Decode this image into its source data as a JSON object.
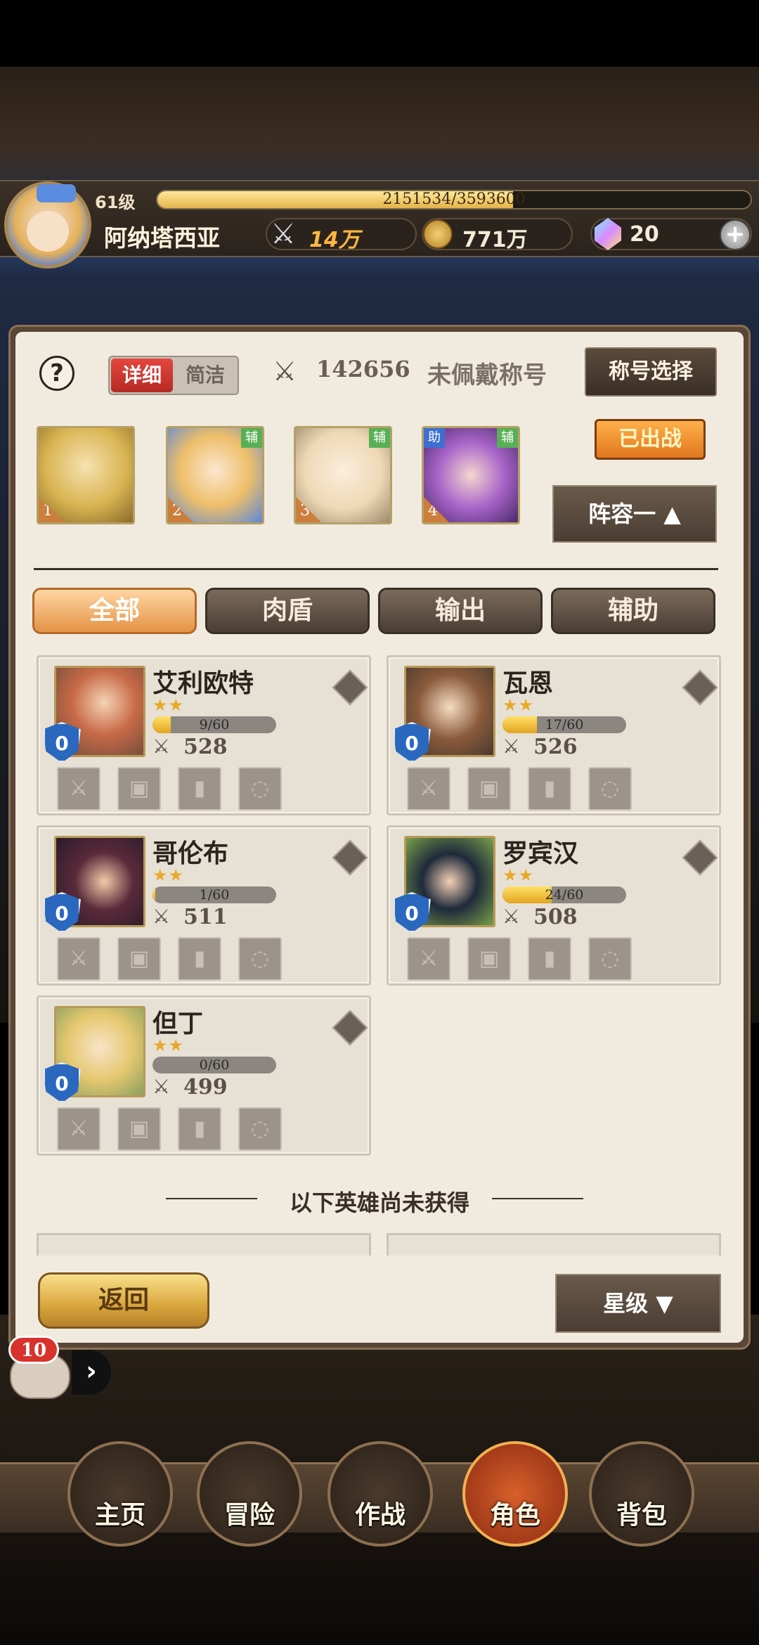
{
  "player": {
    "level": "61级",
    "xp_text": "2151534/3593600",
    "xp_fraction": 0.599,
    "name": "阿纳塔西亚",
    "power": "14万",
    "gold": "771万",
    "gems": "20"
  },
  "panel": {
    "help": "?",
    "mode_detail": "详细",
    "mode_simple": "简洁",
    "team_power": "142656",
    "title_status": "未佩戴称号",
    "title_select": "称号选择",
    "deployed": "已出战",
    "lineup": "阵容一 ▲",
    "team": [
      {
        "num": "1",
        "tags": []
      },
      {
        "num": "2",
        "tags": [
          "辅"
        ]
      },
      {
        "num": "3",
        "tags": [
          "辅"
        ]
      },
      {
        "num": "4",
        "tags": [
          "助",
          "辅"
        ]
      }
    ],
    "filters": [
      "全部",
      "肉盾",
      "输出",
      "辅助"
    ],
    "active_filter": 0
  },
  "heroes": [
    {
      "name": "艾利欧特",
      "stars": "★★",
      "shield": "0",
      "shards": "9/60",
      "fraction": 0.15,
      "power": "528"
    },
    {
      "name": "瓦恩",
      "stars": "★★",
      "shield": "0",
      "shards": "17/60",
      "fraction": 0.28,
      "power": "526"
    },
    {
      "name": "哥伦布",
      "stars": "★★",
      "shield": "0",
      "shards": "1/60",
      "fraction": 0.02,
      "power": "511"
    },
    {
      "name": "罗宾汉",
      "stars": "★★",
      "shield": "0",
      "shards": "24/60",
      "fraction": 0.4,
      "power": "508"
    },
    {
      "name": "但丁",
      "stars": "★★",
      "shield": "0",
      "shards": "0/60",
      "fraction": 0.0,
      "power": "499"
    }
  ],
  "not_owned_label": "以下英雄尚未获得",
  "back": "返回",
  "sort": "星级 ▼",
  "chat": {
    "count": "10",
    "arrow": "›"
  },
  "nav": [
    {
      "label": "主页",
      "icon": "statue-icon"
    },
    {
      "label": "冒险",
      "icon": "portal-icon"
    },
    {
      "label": "作战",
      "icon": "battle-icon"
    },
    {
      "label": "角色",
      "icon": "book-icon"
    },
    {
      "label": "背包",
      "icon": "backpack-icon"
    }
  ],
  "colors": {
    "accent": "#e49346",
    "panel": "#f1ebdf",
    "gold": "#e3b44a"
  }
}
